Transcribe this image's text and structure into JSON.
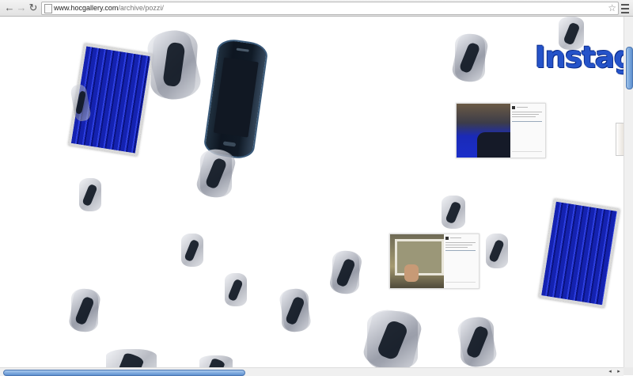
{
  "browser": {
    "url_domain": "www.hocgallery.com",
    "url_path": "/archive/pozzi/",
    "back_icon": "back-arrow-icon",
    "forward_icon": "forward-arrow-icon",
    "reload_icon": "reload-icon",
    "bookmark_icon": "star-icon",
    "menu_icon": "hamburger-menu-icon"
  },
  "page": {
    "instagram_text": "Instag"
  },
  "colors": {
    "instagram_blue": "#2553c9",
    "solar_blue": "#1422b0",
    "scroll_thumb": "#5c8fcf"
  },
  "scrollbar": {
    "left_arrow": "◂",
    "right_arrow": "▸"
  }
}
